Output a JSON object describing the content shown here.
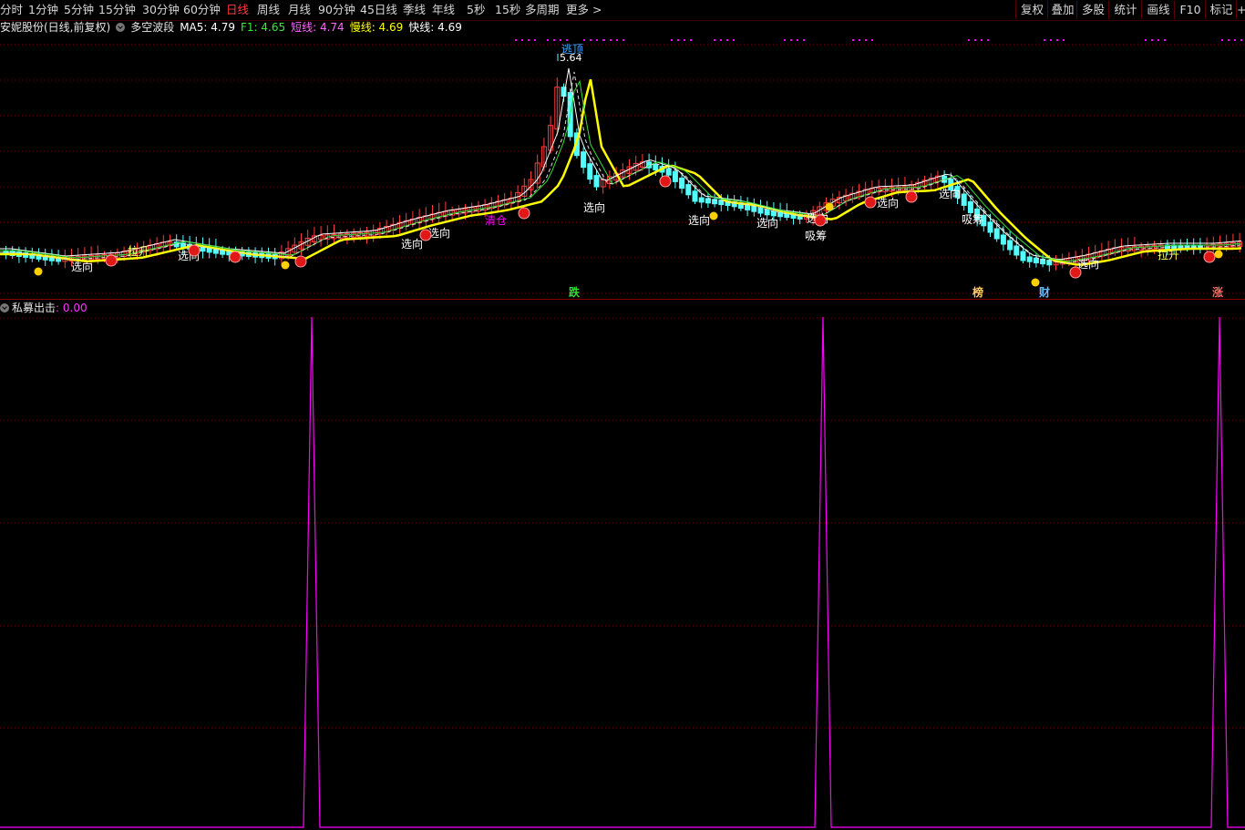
{
  "toolbar": {
    "periods": [
      "分时",
      "1分钟",
      "5分钟",
      "15分钟",
      "30分钟",
      "60分钟",
      "日线",
      "周线",
      "月线",
      "90分钟",
      "45日线",
      "季线",
      "年线",
      "5秒",
      "15秒",
      "多周期",
      "更多 >"
    ],
    "active_period": "日线",
    "right_buttons": [
      "复权",
      "叠加",
      "多股",
      "统计",
      "画线",
      "F10",
      "标记",
      "+"
    ]
  },
  "info": {
    "stock_title": "安妮股份(日线,前复权)",
    "indicator_name": "多空波段",
    "ma5": "MA5: 4.79",
    "f1": "F1: 4.65",
    "short_line": "短线: 4.74",
    "slow_line": "慢线: 4.69",
    "fast_line": "快线: 4.69"
  },
  "colors": {
    "background": "#000000",
    "grid": "#7a0000",
    "up_candle": "#ff3c3c",
    "down_candle": "#54ffff",
    "slow_line": "#ffff00",
    "fast_line": "#ffffff",
    "magenta": "#ff00ff",
    "green_num": "#33dd33",
    "white_label": "#ffffff"
  },
  "main_chart": {
    "peak_label": "5.64",
    "peak_tag": "逃顶",
    "signal_labels": [
      "选向",
      "拉升",
      "选向",
      "选向",
      "选向",
      "清仓",
      "选向",
      "选向",
      "选向",
      "吸筹",
      "选向",
      "选向",
      "选向",
      "吸筹",
      "选向",
      "拉升"
    ],
    "bottom_markers": [
      "跌",
      "榜",
      "财",
      "涨"
    ],
    "badge_char": "多"
  },
  "indicator": {
    "name": "私募出击",
    "value": ": 0.00"
  }
}
